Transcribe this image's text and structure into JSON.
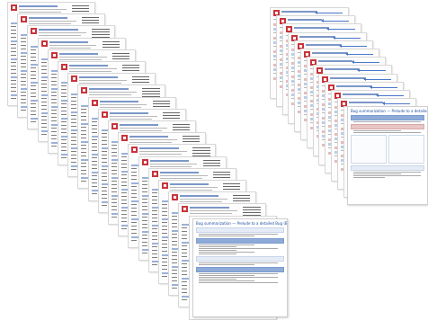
{
  "left_stack": {
    "count": 19
  },
  "right_stack": {
    "count": 13
  },
  "front_left": {
    "title": "Bug summarization — Prelude to a detailed Bug (BITS)"
  },
  "front_right": {
    "title": "Bug summarization — Prelude to a detailed Bug (BITS)"
  },
  "colors": {
    "accent": "#4a78c9",
    "logo": "#c9333a",
    "pink": "#e4bcbc",
    "blue_band": "#8eabd8"
  },
  "icons": [
    "logo-icon",
    "left-arrow-icon"
  ]
}
